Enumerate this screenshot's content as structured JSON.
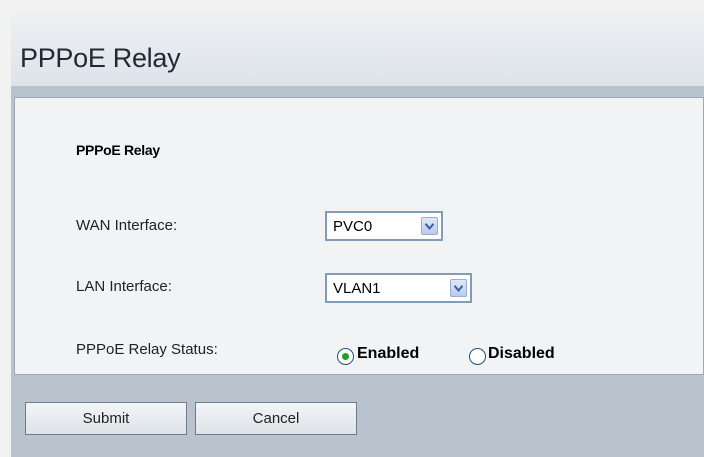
{
  "header": {
    "title": "PPPoE Relay"
  },
  "form": {
    "section_title": "PPPoE Relay",
    "wan_interface": {
      "label": "WAN Interface:",
      "value": "PVC0"
    },
    "lan_interface": {
      "label": "LAN Interface:",
      "value": "VLAN1"
    },
    "relay_status": {
      "label": "PPPoE Relay Status:",
      "options": [
        "Enabled",
        "Disabled"
      ],
      "selected": "Enabled"
    }
  },
  "buttons": {
    "submit": "Submit",
    "cancel": "Cancel"
  },
  "colors": {
    "panel_bg": "#f1f3f5",
    "window_bg": "#b9c3cd",
    "radio_selected": "#21a121"
  },
  "icons": {
    "dropdown": "chevron-down-icon"
  }
}
